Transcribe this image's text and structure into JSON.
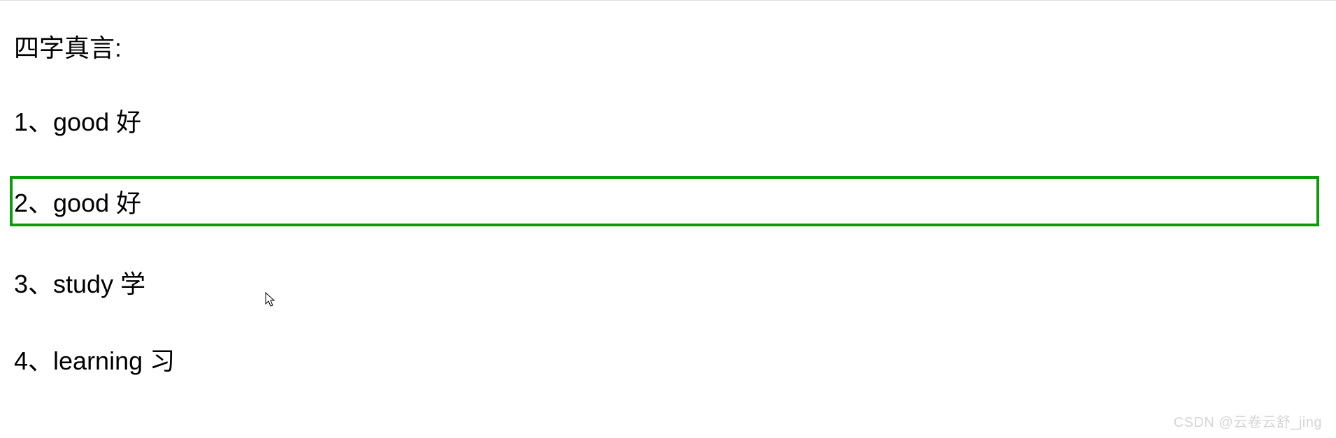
{
  "title": "四字真言:",
  "items": [
    {
      "text": "1、good 好",
      "highlighted": false
    },
    {
      "text": "2、good 好",
      "highlighted": true
    },
    {
      "text": "3、study 学",
      "highlighted": false
    },
    {
      "text": "4、learning 习",
      "highlighted": false
    }
  ],
  "watermark": "CSDN @云卷云舒_jing",
  "highlight_color": "#0b9b0b"
}
